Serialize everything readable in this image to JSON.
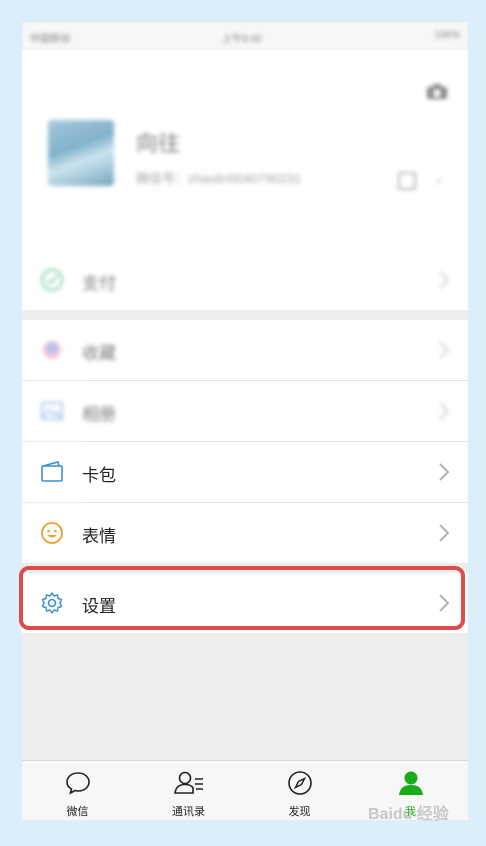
{
  "status_bar": {
    "carrier": "中国移动",
    "time": "上午9:40",
    "battery": "100%"
  },
  "profile": {
    "nickname": "向往",
    "wechat_id": "微信号：zhaolin0040790231"
  },
  "menu": {
    "pay": "支付",
    "favorites": "收藏",
    "album": "相册",
    "cards": "卡包",
    "stickers": "表情",
    "settings": "设置"
  },
  "tabs": [
    {
      "label": "微信"
    },
    {
      "label": "通讯录"
    },
    {
      "label": "发现"
    },
    {
      "label": "我"
    }
  ],
  "colors": {
    "highlight": "#e04a4a",
    "active_tab": "#1aad19",
    "background": "#dceef9"
  },
  "watermark": "Baidu 经验"
}
